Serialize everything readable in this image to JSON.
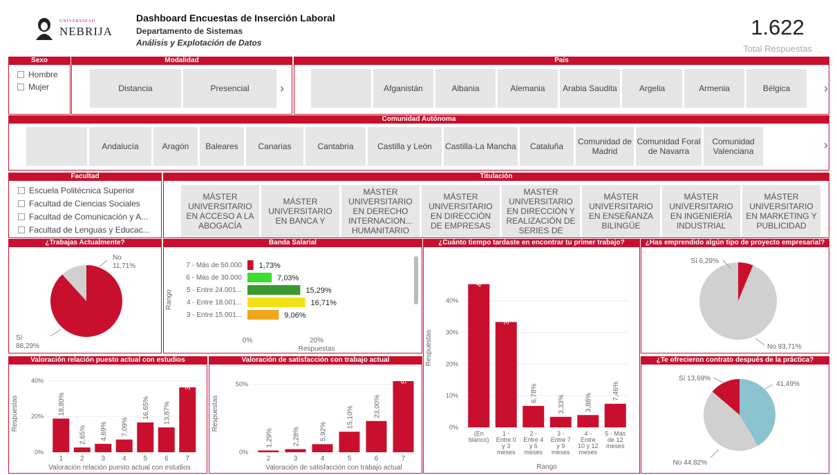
{
  "header": {
    "logo_small": "UNIVERSIDAD",
    "logo_text": "NEBRIJA",
    "title": "Dashboard Encuestas de Inserción Laboral",
    "subtitle": "Departamento de Sistemas",
    "subtitle2": "Análisis y Explotación de Datos",
    "total_value": "1.622",
    "total_label": "Total Respuestas"
  },
  "filters": {
    "sexo": {
      "title": "Sexo",
      "options": [
        "Hombre",
        "Mujer"
      ]
    },
    "modalidad": {
      "title": "Modalidad",
      "options": [
        "Distancia",
        "Presencial"
      ]
    },
    "pais": {
      "title": "País",
      "options": [
        "",
        "Afganistán",
        "Albania",
        "Alemania",
        "Arabia Saudita",
        "Argelia",
        "Armenia",
        "Bélgica"
      ]
    },
    "comunidad": {
      "title": "Comunidad Autónoma",
      "options": [
        "",
        "Andalucía",
        "Aragón",
        "Baleares",
        "Canarias",
        "Cantabria",
        "Castilla y León",
        "Castilla-La Mancha",
        "Cataluña",
        "Comunidad de Madrid",
        "Comunidad Foral de Navarra",
        "Comunidad Valenciana"
      ]
    },
    "facultad": {
      "title": "Facultad",
      "options": [
        "Escuela Politécnica Superior",
        "Facultad de Ciencias Sociales",
        "Facultad de Comunicación y A...",
        "Facultad de Lenguas y Educac..."
      ]
    },
    "titulacion": {
      "title": "Titulación",
      "options": [
        "MÁSTER UNIVERSITARIO EN ACCESO A LA ABOGACÍA",
        "MÁSTER UNIVERSITARIO EN BANCA Y",
        "MÁSTER UNIVERSITARIO EN DERECHO INTERNACION... HUMANITARIO",
        "MÁSTER UNIVERSITARIO EN DIRECCIÓN DE EMPRESAS",
        "MASTER UNIVERSITARIO EN DIRECCIÓN Y REALIZACIÓN DE SERIES DE",
        "MÁSTER UNIVERSITARIO EN ENSEÑANZA BILINGÜE",
        "MÁSTER UNIVERSITARIO EN INGENIERÍA INDUSTRIAL",
        "MÁSTER UNIVERSITARIO EN MARKETING Y PUBLICIDAD"
      ]
    }
  },
  "colors": {
    "primary": "#c8102e",
    "grey": "#d0d0d0",
    "teal": "#8cc3d1",
    "green": "#3ddc2e",
    "yellow": "#f2e21a",
    "orange": "#f0a81a"
  },
  "chart_data": [
    {
      "id": "trabajas",
      "type": "pie",
      "title": "¿Trabajas Actualmente?",
      "labels": [
        "Sí",
        "No"
      ],
      "values": [
        88.29,
        11.71
      ],
      "value_labels": [
        "88,29%",
        "11,71%"
      ],
      "colors": [
        "#c8102e",
        "#d0d0d0"
      ]
    },
    {
      "id": "banda",
      "type": "bar",
      "orientation": "horizontal",
      "title": "Banda Salarial",
      "ylabel": "Rango",
      "xlabel": "Respuestas",
      "categories": [
        "7 - Más de 50.000",
        "6 - Más de 30.000",
        "5 - Entre 24.001...",
        "4 - Entre 18.001...",
        "3 - Entre 15.001..."
      ],
      "values": [
        1.73,
        7.03,
        15.29,
        16.71,
        9.06
      ],
      "value_labels": [
        "1,73%",
        "7,03%",
        "15,29%",
        "16,71%",
        "9,06%"
      ],
      "colors": [
        "#c8102e",
        "#3ddc2e",
        "#3a9a2e",
        "#f2e21a",
        "#f0a81a"
      ],
      "xticks": [
        "0%",
        "20%"
      ]
    },
    {
      "id": "tiempo",
      "type": "bar",
      "title": "¿Cuánto tiempo tardaste en encontrar tu primer trabajo?",
      "ylabel": "Respuestas",
      "xlabel": "Rango",
      "categories": [
        "(En blanco)",
        "1 - Entre 0 y 3 meses",
        "2 - Entre 4 y 6 meses",
        "3 - Entre 7 y 9 meses",
        "4 - Entre 10 y 12 meses",
        "5 - Más de 12 meses"
      ],
      "values": [
        45.25,
        33.29,
        6.78,
        3.33,
        3.88,
        7.46
      ],
      "value_labels": [
        "45,25%",
        "33,29%",
        "6,78%",
        "3,33%",
        "3,88%",
        "7,46%"
      ],
      "ylim": [
        0,
        48
      ],
      "yticks": [
        "0%",
        "10%",
        "20%",
        "30%",
        "40%"
      ]
    },
    {
      "id": "emprendido",
      "type": "pie",
      "title": "¿Has emprendido algún tipo de proyecto empresarial?",
      "labels": [
        "Sí",
        "No"
      ],
      "values": [
        6.29,
        93.71
      ],
      "value_labels": [
        "Sí 6,29%",
        "No 93,71%"
      ],
      "colors": [
        "#c8102e",
        "#d0d0d0"
      ]
    },
    {
      "id": "relacion",
      "type": "bar",
      "title": "Valoración relación puesto actual con estudios",
      "ylabel": "Respuestas",
      "xlabel": "Valoración relación puesto actual con estudios",
      "categories": [
        "1",
        "2",
        "3",
        "4",
        "5",
        "6",
        "7"
      ],
      "values": [
        18.8,
        2.65,
        4.69,
        7.09,
        16.65,
        13.87,
        36.25
      ],
      "value_labels": [
        "18,80%",
        "2,65%",
        "4,69%",
        "7,09%",
        "16,65%",
        "13,87%",
        "36,25%"
      ],
      "ylim": [
        0,
        44
      ],
      "yticks": [
        "0%",
        "20%",
        "40%"
      ]
    },
    {
      "id": "satisfaccion",
      "type": "bar",
      "title": "Valoración de satisfacción con trabajo actual",
      "ylabel": "Respuestas",
      "xlabel": "Valoración de satisfacción con trabajo actual",
      "categories": [
        "2",
        "3",
        "4",
        "5",
        "6",
        "7"
      ],
      "values": [
        1.29,
        2.28,
        5.92,
        15.1,
        23.0,
        52.4
      ],
      "value_labels": [
        "1,29%",
        "2,28%",
        "5,92%",
        "15,10%",
        "23,00%",
        "52,40%"
      ],
      "ylim": [
        0,
        58
      ],
      "yticks": [
        "0%",
        "50%"
      ]
    },
    {
      "id": "contrato",
      "type": "pie",
      "title": "¿Te ofrecieron contrato después de la práctica?",
      "labels": [
        "Sí",
        "No",
        ""
      ],
      "values": [
        13.69,
        44.82,
        41.49
      ],
      "value_labels": [
        "Sí 13,69%",
        "No 44,82%",
        "41,49%"
      ],
      "colors": [
        "#c8102e",
        "#d0d0d0",
        "#8cc3d1"
      ]
    }
  ]
}
